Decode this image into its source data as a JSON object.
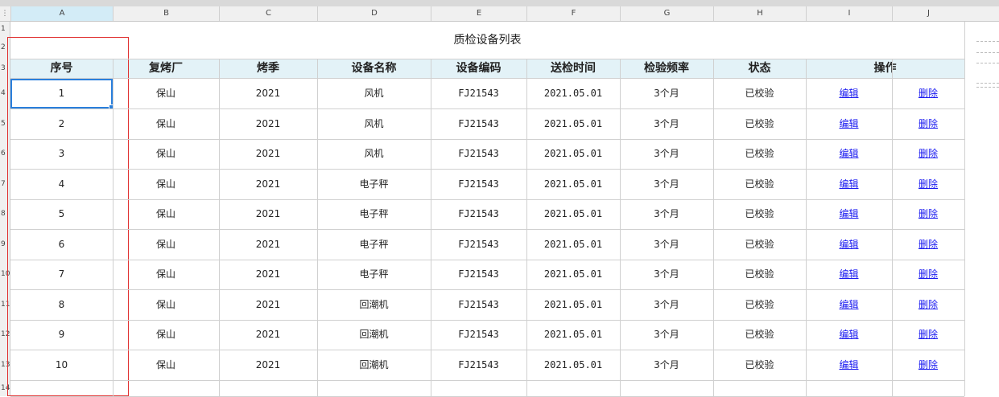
{
  "column_letters": [
    "A",
    "B",
    "C",
    "D",
    "E",
    "F",
    "G",
    "H",
    "I",
    "J"
  ],
  "row_numbers": [
    "1",
    "2",
    "3",
    "4",
    "5",
    "6",
    "7",
    "8",
    "9",
    "10",
    "11",
    "12",
    "13",
    "14"
  ],
  "title": "质检设备列表",
  "headers": [
    "序号",
    "复烤厂",
    "烤季",
    "设备名称",
    "设备编码",
    "送检时间",
    "检验频率",
    "状态",
    "操作"
  ],
  "rows": [
    {
      "no": "1",
      "factory": "保山",
      "season": "2021",
      "name": "风机",
      "code": "FJ21543",
      "date": "2021.05.01",
      "freq": "3个月",
      "status": "已校验",
      "edit": "编辑",
      "delete": "删除"
    },
    {
      "no": "2",
      "factory": "保山",
      "season": "2021",
      "name": "风机",
      "code": "FJ21543",
      "date": "2021.05.01",
      "freq": "3个月",
      "status": "已校验",
      "edit": "编辑",
      "delete": "删除"
    },
    {
      "no": "3",
      "factory": "保山",
      "season": "2021",
      "name": "风机",
      "code": "FJ21543",
      "date": "2021.05.01",
      "freq": "3个月",
      "status": "已校验",
      "edit": "编辑",
      "delete": "删除"
    },
    {
      "no": "4",
      "factory": "保山",
      "season": "2021",
      "name": "电子秤",
      "code": "FJ21543",
      "date": "2021.05.01",
      "freq": "3个月",
      "status": "已校验",
      "edit": "编辑",
      "delete": "删除"
    },
    {
      "no": "5",
      "factory": "保山",
      "season": "2021",
      "name": "电子秤",
      "code": "FJ21543",
      "date": "2021.05.01",
      "freq": "3个月",
      "status": "已校验",
      "edit": "编辑",
      "delete": "删除"
    },
    {
      "no": "6",
      "factory": "保山",
      "season": "2021",
      "name": "电子秤",
      "code": "FJ21543",
      "date": "2021.05.01",
      "freq": "3个月",
      "status": "已校验",
      "edit": "编辑",
      "delete": "删除"
    },
    {
      "no": "7",
      "factory": "保山",
      "season": "2021",
      "name": "电子秤",
      "code": "FJ21543",
      "date": "2021.05.01",
      "freq": "3个月",
      "status": "已校验",
      "edit": "编辑",
      "delete": "删除"
    },
    {
      "no": "8",
      "factory": "保山",
      "season": "2021",
      "name": "回潮机",
      "code": "FJ21543",
      "date": "2021.05.01",
      "freq": "3个月",
      "status": "已校验",
      "edit": "编辑",
      "delete": "删除"
    },
    {
      "no": "9",
      "factory": "保山",
      "season": "2021",
      "name": "回潮机",
      "code": "FJ21543",
      "date": "2021.05.01",
      "freq": "3个月",
      "status": "已校验",
      "edit": "编辑",
      "delete": "删除"
    },
    {
      "no": "10",
      "factory": "保山",
      "season": "2021",
      "name": "回潮机",
      "code": "FJ21543",
      "date": "2021.05.01",
      "freq": "3个月",
      "status": "已校验",
      "edit": "编辑",
      "delete": "删除"
    }
  ],
  "selected_cell": "A4",
  "colors": {
    "header_fill": "#e3f2f7",
    "link": "#1a1af0",
    "selection": "#2a7fdc",
    "highlight_box": "#e03030"
  }
}
